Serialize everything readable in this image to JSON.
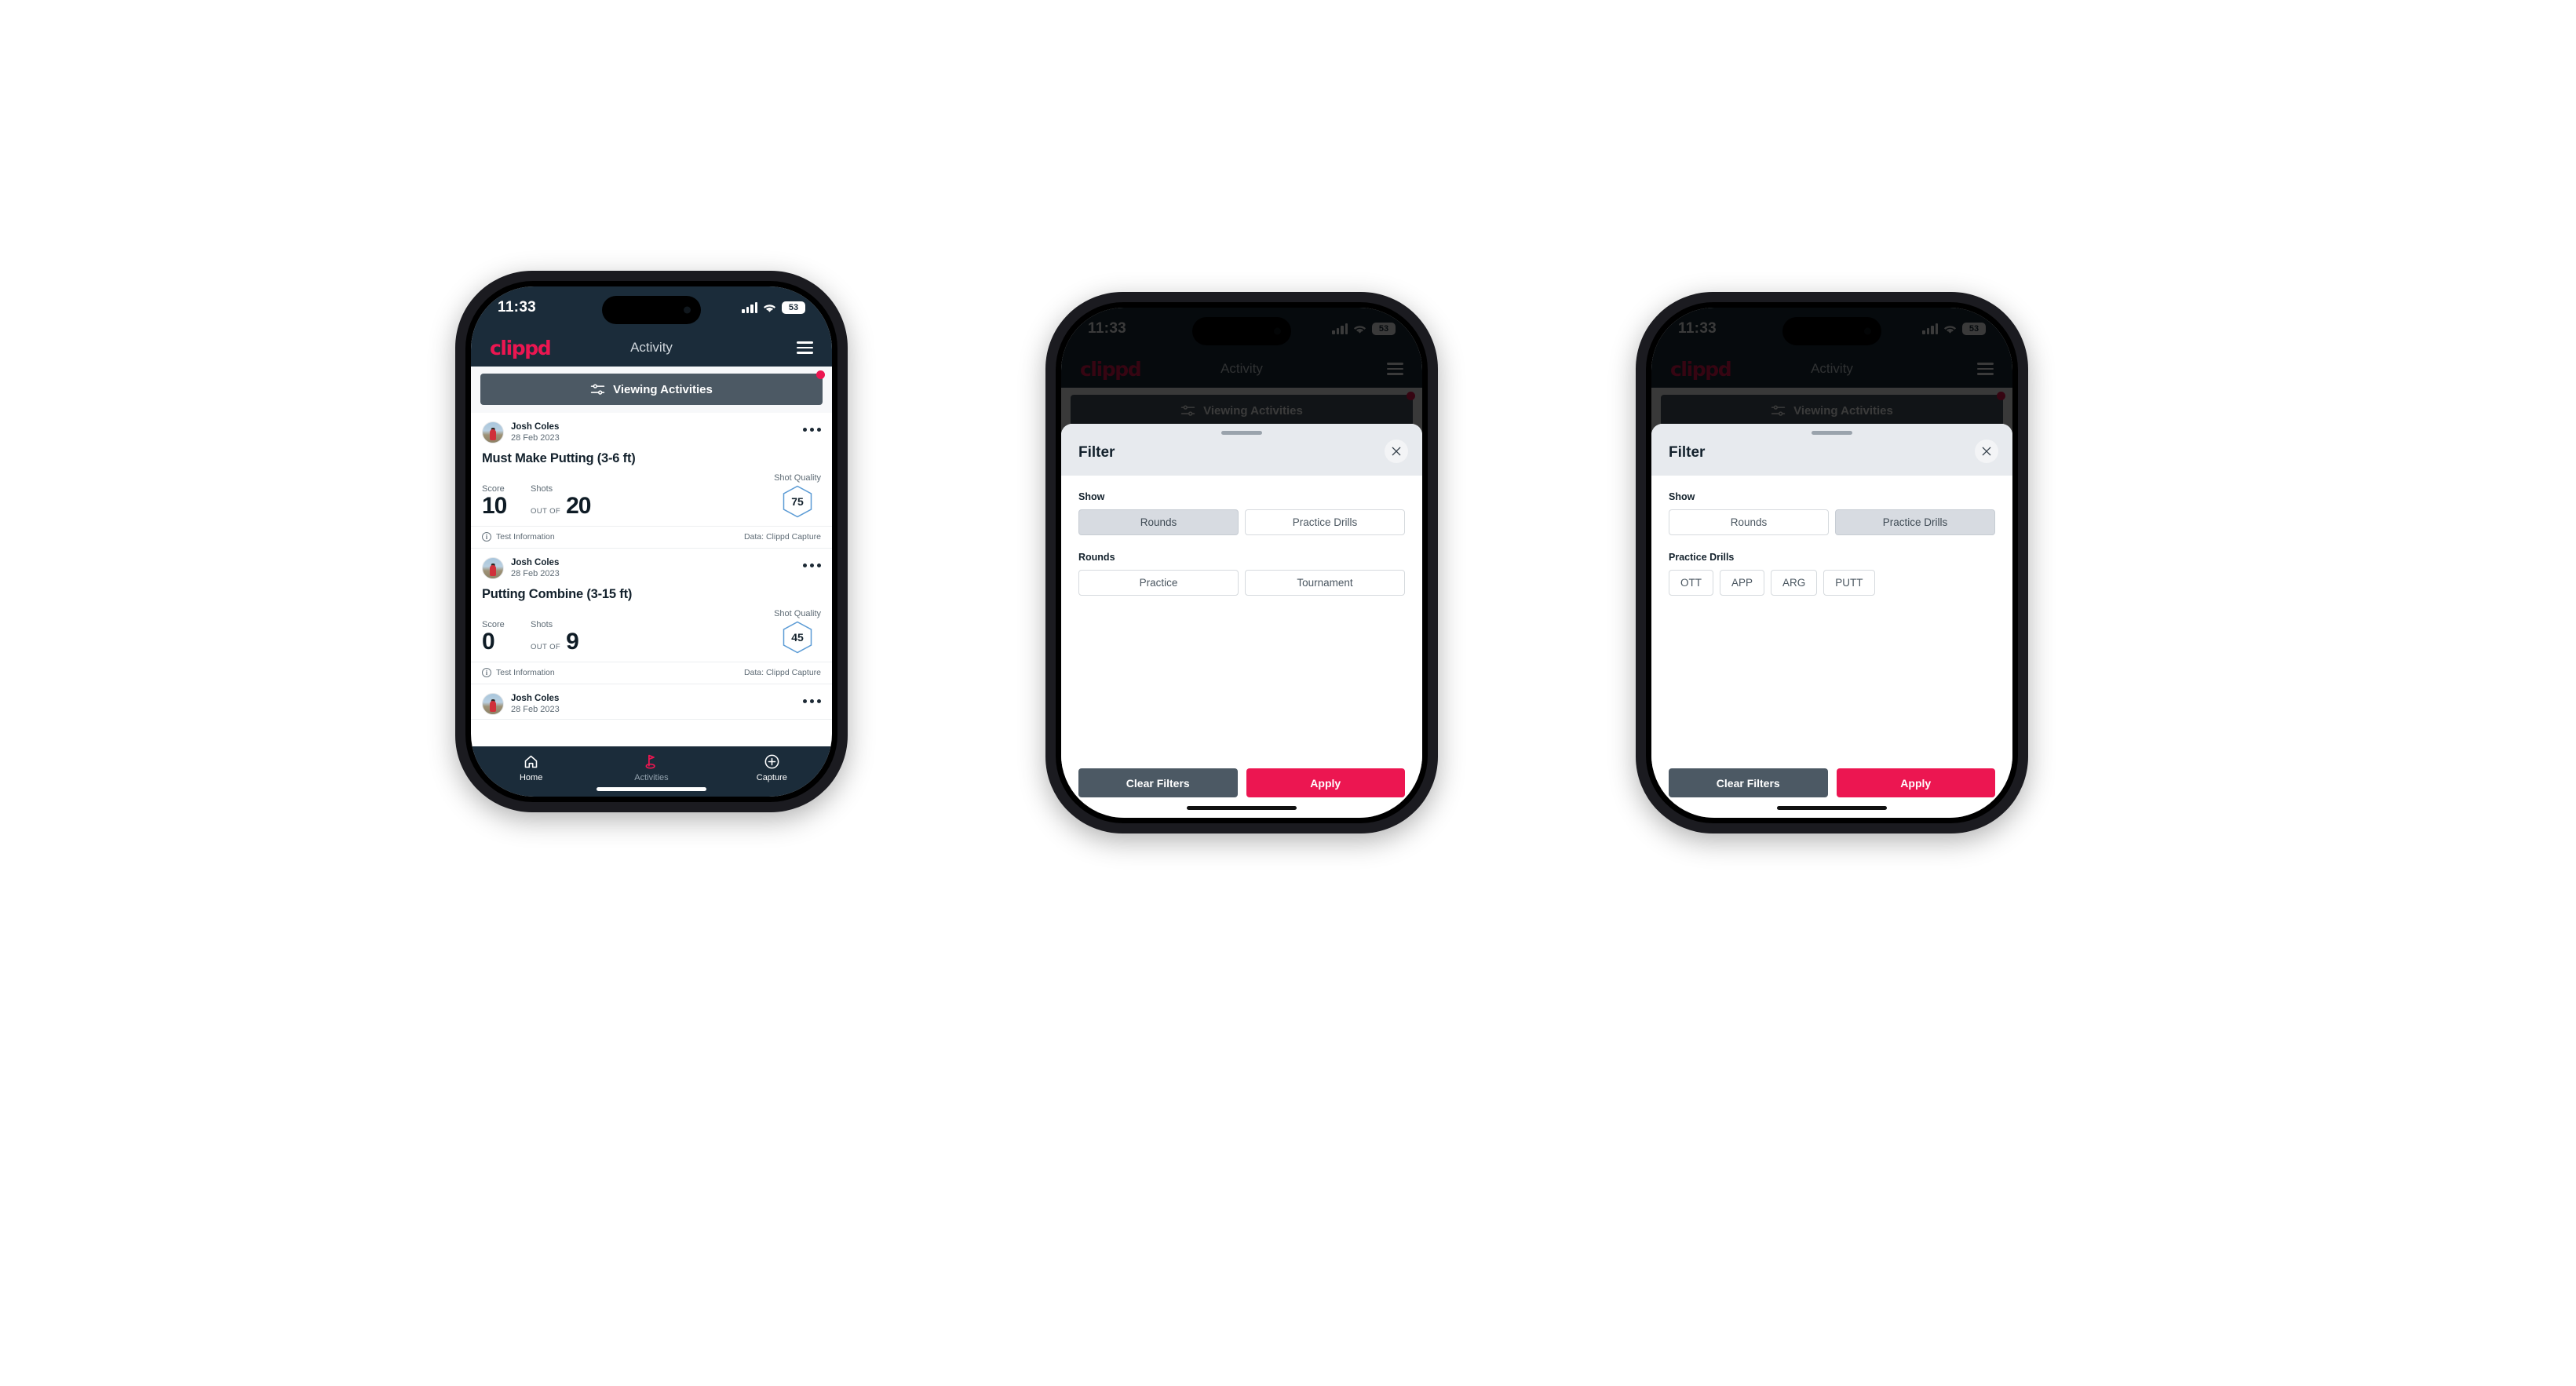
{
  "statusbar": {
    "time": "11:33",
    "battery": "53"
  },
  "appbar": {
    "logo": "clippd",
    "title": "Activity",
    "menu_icon": "hamburger-menu-icon"
  },
  "filterbar": {
    "label": "Viewing Activities",
    "icon": "tune-sliders-icon",
    "has_badge": true
  },
  "feed": {
    "cards": [
      {
        "user": "Josh Coles",
        "date": "28 Feb 2023",
        "title": "Must Make Putting (3-6 ft)",
        "score_label": "Score",
        "score_value": "10",
        "outof_label": "OUT OF",
        "shots_label": "Shots",
        "shots_value": "20",
        "quality_label": "Shot Quality",
        "quality_value": "75",
        "footer_left": "Test Information",
        "footer_right": "Data: Clippd Capture"
      },
      {
        "user": "Josh Coles",
        "date": "28 Feb 2023",
        "title": "Putting Combine (3-15 ft)",
        "score_label": "Score",
        "score_value": "0",
        "outof_label": "OUT OF",
        "shots_label": "Shots",
        "shots_value": "9",
        "quality_label": "Shot Quality",
        "quality_value": "45",
        "footer_left": "Test Information",
        "footer_right": "Data: Clippd Capture"
      },
      {
        "user": "Josh Coles",
        "date": "28 Feb 2023"
      }
    ]
  },
  "bottomnav": {
    "items": [
      {
        "label": "Home",
        "icon": "home-icon",
        "active": false
      },
      {
        "label": "Activities",
        "icon": "golf-flag-icon",
        "active": true
      },
      {
        "label": "Capture",
        "icon": "plus-circle-icon",
        "active": false
      }
    ]
  },
  "filter_sheet": {
    "title": "Filter",
    "close_icon": "close-x-icon",
    "show_label": "Show",
    "show_options": [
      "Rounds",
      "Practice Drills"
    ],
    "rounds_label": "Rounds",
    "rounds_options": [
      "Practice",
      "Tournament"
    ],
    "drills_label": "Practice Drills",
    "drills_options": [
      "OTT",
      "APP",
      "ARG",
      "PUTT"
    ],
    "clear_label": "Clear Filters",
    "apply_label": "Apply",
    "phone2_selected_show": "Rounds",
    "phone3_selected_show": "Practice Drills"
  },
  "colors": {
    "header_navy": "#1b2c3a",
    "brand_pink": "#ec1651",
    "slate": "#4c5964",
    "chip_selected": "#d7dbe1",
    "hex_blue": "#5b9bd5"
  }
}
